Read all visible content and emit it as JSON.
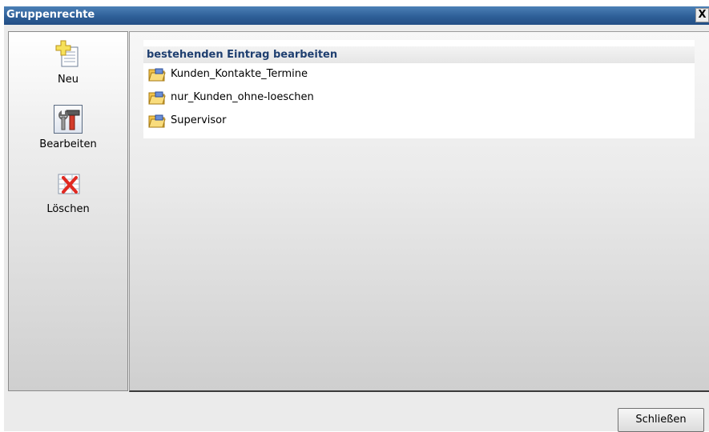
{
  "window": {
    "title": "Gruppenrechte",
    "close_glyph": "X"
  },
  "sidebar": {
    "items": [
      {
        "label": "Neu",
        "icon": "new-document-icon",
        "selected": false
      },
      {
        "label": "Bearbeiten",
        "icon": "tools-icon",
        "selected": true
      },
      {
        "label": "Löschen",
        "icon": "delete-grid-icon",
        "selected": false
      }
    ]
  },
  "main": {
    "header": "bestehenden Eintrag bearbeiten",
    "entries": [
      {
        "label": "Kunden_Kontakte_Termine",
        "icon": "folder-icon"
      },
      {
        "label": "nur_Kunden_ohne-loeschen",
        "icon": "folder-icon"
      },
      {
        "label": "Supervisor",
        "icon": "folder-icon"
      }
    ]
  },
  "footer": {
    "close_label": "Schließen"
  },
  "colors": {
    "titlebar": "#2e5f98",
    "header_text": "#1f3f70",
    "folder": "#f2c34a"
  }
}
